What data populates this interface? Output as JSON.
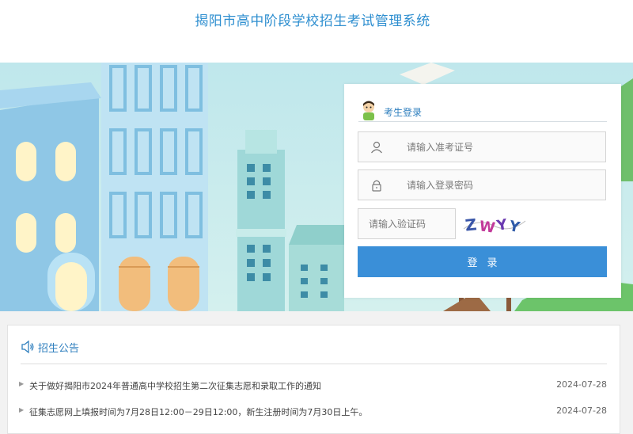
{
  "header": {
    "title": "揭阳市高中阶段学校招生考试管理系统"
  },
  "login": {
    "title": "考生登录",
    "exam_id_placeholder": "请输入准考证号",
    "password_placeholder": "请输入登录密码",
    "captcha_placeholder": "请输入验证码",
    "captcha_text": "ZWYY",
    "submit_label": "登录",
    "accent_color": "#3a8fd8"
  },
  "notice": {
    "title": "招生公告",
    "items": [
      {
        "text": "关于做好揭阳市2024年普通高中学校招生第二次征集志愿和录取工作的通知",
        "date": "2024-07-28"
      },
      {
        "text": "征集志愿网上填报时间为7月28日12:00－29日12:00，新生注册时间为7月30日上午。",
        "date": "2024-07-28"
      }
    ]
  }
}
